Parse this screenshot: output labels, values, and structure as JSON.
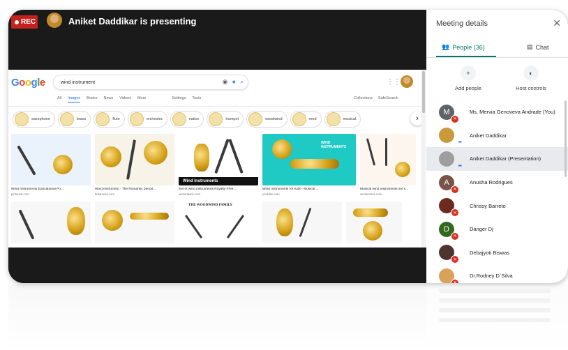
{
  "meeting": {
    "rec_label": "REC",
    "presenter_text": "Aniket Daddikar is presenting"
  },
  "shared_screen": {
    "search": {
      "value": "wind instrument"
    },
    "tabs": [
      {
        "label": "All",
        "active": false
      },
      {
        "label": "Images",
        "active": true
      },
      {
        "label": "Books",
        "active": false
      },
      {
        "label": "News",
        "active": false
      },
      {
        "label": "Videos",
        "active": false
      },
      {
        "label": "More",
        "active": false
      }
    ],
    "tools": [
      "Settings",
      "Tools"
    ],
    "right_tools": [
      "Collections",
      "SafeSearch"
    ],
    "chips": [
      "saxophone",
      "brass",
      "flute",
      "orchestra",
      "native",
      "trumpet",
      "woodwind",
      "reed",
      "musical"
    ],
    "results": [
      {
        "caption": "Wind Instruments Educational Po...",
        "source": "pinterest.com"
      },
      {
        "caption": "Wind instrument - The Romantic period ...",
        "source": "britannica.com"
      },
      {
        "caption": "Set of wind instruments Royalty Free ...",
        "source": "vectorstock.com"
      },
      {
        "caption": "Wind Instruments for Kids - Musical ...",
        "source": "youtube.com"
      },
      {
        "caption": "Musical wind instruments set s...",
        "source": "vectorstock.com"
      }
    ],
    "tile_texts": {
      "wind_label": "Wind Instruments",
      "teal_label": "WIND INSTRUMENTS",
      "woodwind_family": "THE WOODWIND FAMILY"
    }
  },
  "panel": {
    "title": "Meeting details",
    "tabs": {
      "people": "People (36)",
      "chat": "Chat"
    },
    "actions": {
      "add_people": "Add people",
      "host_controls": "Host controls"
    },
    "participants": [
      {
        "name": "Ms. Mervia Genoveva Andrade (You)",
        "initial": "M",
        "color": "#5f6368",
        "muted": true
      },
      {
        "name": "Aniket Daddikar",
        "initial": "",
        "color": "#c99a3c",
        "muted": false,
        "talking": true
      },
      {
        "name": "Aniket Daddikar (Presentation)",
        "initial": "",
        "color": "#9e9e9e",
        "muted": false,
        "talking": true
      },
      {
        "name": "Anusha Rodrigues",
        "initial": "A",
        "color": "#795548",
        "muted": true
      },
      {
        "name": "Chrissy Barreto",
        "initial": "",
        "color": "#6d2b1f",
        "muted": true
      },
      {
        "name": "Danger Dj",
        "initial": "D",
        "color": "#33691e",
        "muted": true
      },
      {
        "name": "Debajyoti Biswas",
        "initial": "",
        "color": "#4e342e",
        "muted": true
      },
      {
        "name": "Dr.Rodney D`Silva",
        "initial": "",
        "color": "#d9a25c",
        "muted": true
      }
    ]
  },
  "icons": {
    "close": "close-icon",
    "people": "people-icon",
    "chat": "chat-icon",
    "add_person": "add-person-icon",
    "host_controls": "toggle-icon",
    "mic_off": "mic-off-icon"
  }
}
